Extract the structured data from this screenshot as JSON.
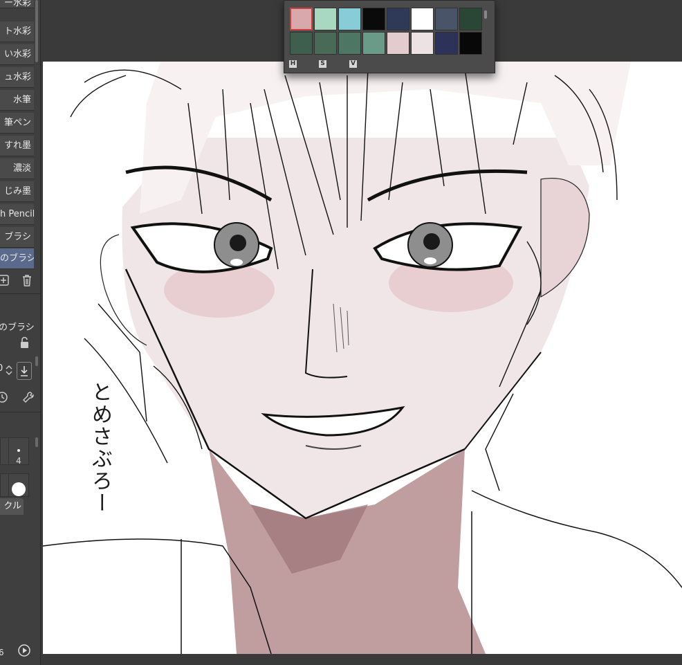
{
  "app": {
    "ui_colors": {
      "panel": "#3f3f3f",
      "selected": "#5b6a8c",
      "canvas": "#ffffff",
      "accent": "#c9403f"
    }
  },
  "sidebar": {
    "brushes": [
      {
        "label": "ー水彩"
      },
      {
        "label": "ト水彩"
      },
      {
        "label": "い水彩"
      },
      {
        "label": "ュ水彩"
      },
      {
        "label": "水筆"
      },
      {
        "label": "筆ペン"
      },
      {
        "label": "すれ墨"
      },
      {
        "label": "濃淡"
      },
      {
        "label": "じみ墨"
      },
      {
        "label": "h Pencil"
      },
      {
        "label": "ブラシ"
      },
      {
        "label": "のブラシ"
      }
    ],
    "current_brush_label": "のブラシ",
    "size_value": "0",
    "brush_size_cell": "4",
    "tab_label": "クル",
    "bottom_number": "6",
    "icons": {
      "add": "add-layer-icon",
      "delete": "trash-icon",
      "lock": "lock-icon",
      "stepper": "stepper-icon",
      "download": "download-icon",
      "history": "history-icon",
      "wrench": "wrench-icon",
      "play": "play-icon"
    }
  },
  "palette": {
    "swatches": [
      "#d8a8ac",
      "#a8d8c0",
      "#88ccd8",
      "#0a0a0a",
      "#2e3a58",
      "#ffffff",
      "#4a5468",
      "#2a4634",
      "#3e5e4e",
      "#4a6a58",
      "#4e7664",
      "#6a9a88",
      "#e4ccce",
      "#ece2e4",
      "#2c3258",
      "#080808"
    ],
    "selected_index": 0,
    "hsv_labels": [
      "H",
      "S",
      "V"
    ]
  },
  "canvas": {
    "signature_text": "とめさぶろー"
  }
}
